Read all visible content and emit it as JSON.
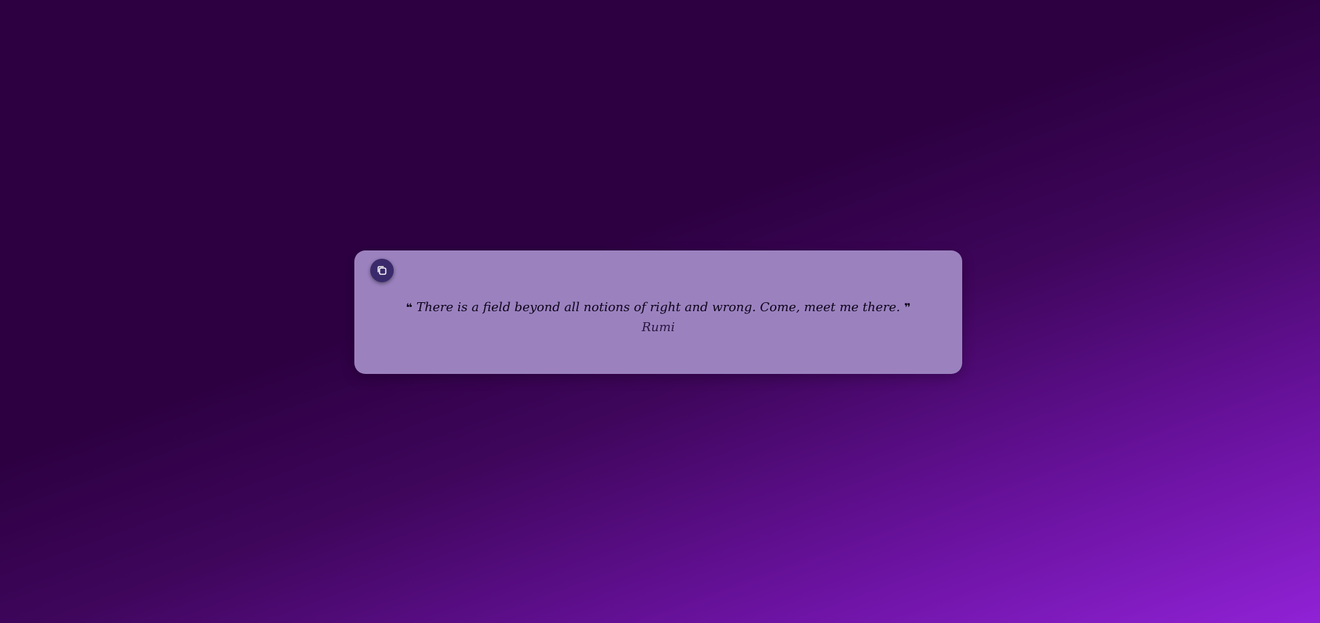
{
  "quote_card": {
    "copy_icon": "copy-icon",
    "open_quote_mark": "❝",
    "close_quote_mark": "❞",
    "quote_text": "There is a field beyond all notions of right and wrong. Come, meet me there.",
    "author": "Rumi"
  },
  "colors": {
    "card_background": "#9b82bf",
    "copy_button": "#3b2a6b",
    "quote_text": "#0c0318",
    "author_text": "#2a1640"
  }
}
